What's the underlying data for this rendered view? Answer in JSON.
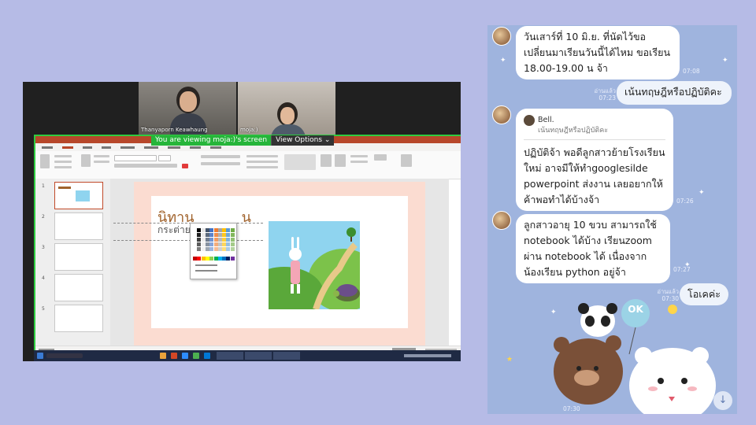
{
  "zoom": {
    "participants": [
      {
        "name": "Thanyaporn Keawhaung"
      },
      {
        "name": "moja:)"
      }
    ],
    "share_banner": {
      "message": "You are viewing moja:)'s screen",
      "options_label": "View Options ⌄"
    },
    "slide": {
      "title": "นิทาน",
      "title_end": "น",
      "subtitle": "กระต่าย"
    }
  },
  "chat": {
    "messages": [
      {
        "sender": "other",
        "text": "วันเสาร์ที่ 10 มิ.ย. ที่นัดไว้ขอเปลี่ยนมาเรียนวันนี้ได้ไหม ขอเรียน 18.00-19.00 น จ้า",
        "time": "07:08"
      },
      {
        "sender": "me",
        "text": "เน้นทฤษฎีหรือปฏิบัติคะ",
        "read": "อ่านแล้ว",
        "time": "07:23"
      },
      {
        "sender": "other",
        "reply_to_name": "Bell.",
        "reply_to_text": "เน้นทฤษฎีหรือปฏิบัติคะ",
        "text": "ปฏิบัติจ้า พอดีลูกสาวย้ายโรงเรียนใหม่ อาจมีให้ทำgooglesilde powerpoint ส่งงาน เลยอยากให้ค้าพอทำได้บ้างจ้า",
        "time": "07:26"
      },
      {
        "sender": "other",
        "text": "ลูกสาวอายุ 10 ขวบ สามารถใช้ notebook ได้บ้าง เรียนzoom ผ่าน notebook ได้ เนื่องจากน้องเรียน python อยู่จ้า",
        "time": "07:27"
      },
      {
        "sender": "me",
        "text": "โอเคค่ะ",
        "read": "อ่านแล้ว",
        "time": "07:30"
      }
    ],
    "sticker": {
      "ok_text": "OK"
    },
    "bottom_time": "07:30",
    "scroll_down_icon": "arrow-down-icon"
  }
}
